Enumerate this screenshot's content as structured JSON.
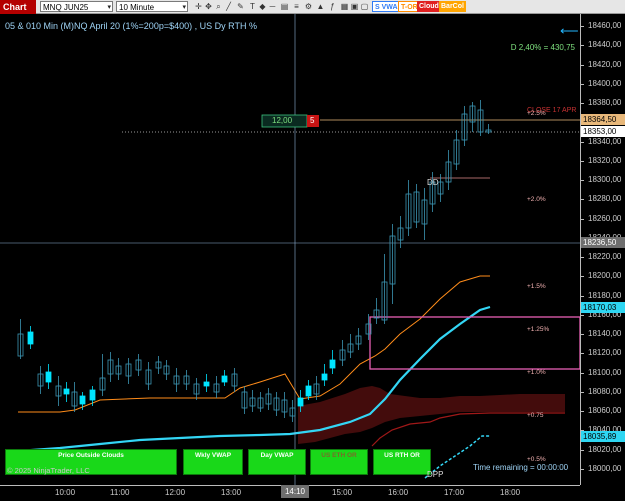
{
  "toolbar": {
    "chart_tab": "Chart",
    "instrument": "MNQ JUN25",
    "interval": "10 Minute",
    "buttons": [
      {
        "label": "S VWAP",
        "color": "#2f7bf5"
      },
      {
        "label": "T-OR",
        "color": "#ff8c00"
      },
      {
        "label": "Cloud",
        "color": "#e02020"
      },
      {
        "label": "BarCol",
        "color": "#ffa500"
      }
    ],
    "icons": [
      "crosshair-icon",
      "pan-icon",
      "zoom-icon",
      "draw-icon",
      "pen-icon",
      "text-icon",
      "marker-icon",
      "price-line-icon",
      "channel-icon",
      "fib-icon",
      "properties-icon",
      "strategy-icon",
      "indicator-icon",
      "template-icon",
      "layout-icon",
      "screenshot-icon",
      "lock-icon",
      "link-icon"
    ]
  },
  "chart": {
    "title": "05 & 010 Min (M)NQ  April 20 (1%=200p=$400) , US Dy RTH %",
    "delta_stat": "D 2,40% = 430,75",
    "close_label": "CLOSE 17 APR",
    "qty_value": "12,00",
    "qty_badge": "5",
    "level_labels": {
      "p25": "+2.5%",
      "p20": "+2.0%",
      "p15": "+1.5%",
      "p125": "+1.25%",
      "p10": "+1.0%",
      "p075": "+0.75",
      "p05": "+0.5%"
    },
    "dd_label": "DD",
    "dpp_label": "DPP",
    "copyright": "© 2025 NinjaTrader, LLC",
    "time_remaining": "Time remaining = 00:00:00",
    "bottom_boxes": [
      "Price Outside Clouds",
      "Wkly VWAP",
      "Day VWAP",
      "US ETH OR",
      "US RTH OR"
    ],
    "crosshair_time": "14:10"
  },
  "y_axis": {
    "ticks": [
      "18460,00",
      "18440,00",
      "18420,00",
      "18400,00",
      "18380,00",
      "18360,00",
      "18340,00",
      "18320,00",
      "18300,00",
      "18280,00",
      "18260,00",
      "18240,00",
      "18220,00",
      "18200,00",
      "18180,00",
      "18160,00",
      "18140,00",
      "18120,00",
      "18100,00",
      "18080,00",
      "18060,00",
      "18040,00",
      "18020,00",
      "18000,00"
    ],
    "price_boxes": [
      {
        "value": "18364,50",
        "bg": "#e8b87a",
        "fg": "#000"
      },
      {
        "value": "18353,00",
        "bg": "#ffffff",
        "fg": "#000"
      },
      {
        "value": "18236,50",
        "bg": "#6e6e6e",
        "fg": "#fff"
      },
      {
        "value": "18170,03",
        "bg": "#2ed6f2",
        "fg": "#000"
      },
      {
        "value": "18035,89",
        "bg": "#2ed6f2",
        "fg": "#000"
      }
    ]
  },
  "x_axis": {
    "ticks": [
      "10:00",
      "11:00",
      "12:00",
      "13:00",
      "15:00",
      "16:00",
      "17:00",
      "18:00"
    ]
  },
  "colors": {
    "bull": "#00e5ff",
    "bear": "#3c96b4",
    "orange": "#ff8c1a",
    "vwap": "#33d6f5",
    "pink": "#e85fb4",
    "cloud": "#4a0d0d",
    "red_line": "#a01818",
    "green_text": "#7ee07e"
  }
}
